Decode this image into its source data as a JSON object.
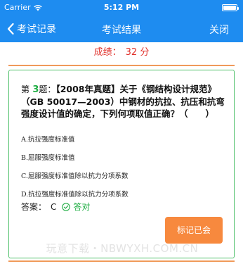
{
  "status_bar": {
    "carrier": "Carrier",
    "time": "5:12 PM"
  },
  "nav": {
    "back_label": "考试记录",
    "title": "考试结果",
    "close_label": "关闭"
  },
  "score": {
    "label": "成绩：",
    "value": "32 分"
  },
  "question": {
    "prefix_before": "第",
    "number": "3",
    "prefix_after": "题：",
    "text": "【2008年真题】关于《钢结构设计规范》（GB 50017—2003）中钢材的抗拉、抗压和抗弯强度设计值的确定，下列何项取值正确？（　　）",
    "options": [
      {
        "label": "A.抗拉强度标准值"
      },
      {
        "label": "B.屈服强度标准值"
      },
      {
        "label": "C.屈服强度标准值除以抗力分项系数"
      },
      {
        "label": "D.抗拉强度标准值除以抗力分项系数"
      }
    ],
    "answer_label": "答案：",
    "answer_value": "C",
    "result_text": "答对"
  },
  "mark_button_label": "标记已会",
  "watermark": "玩意下载・NBWYXH.COM.CN",
  "colors": {
    "primary": "#1e8cf0",
    "score_red": "#e0302a",
    "correct_green": "#1fae43",
    "card_border": "#4fc06a",
    "button_orange": "#f7893e",
    "divider_orange": "#f09a5a"
  },
  "icons": {
    "wifi": "wifi-icon",
    "battery": "battery-icon",
    "back": "chevron-left-icon",
    "correct": "check-circle-icon"
  }
}
